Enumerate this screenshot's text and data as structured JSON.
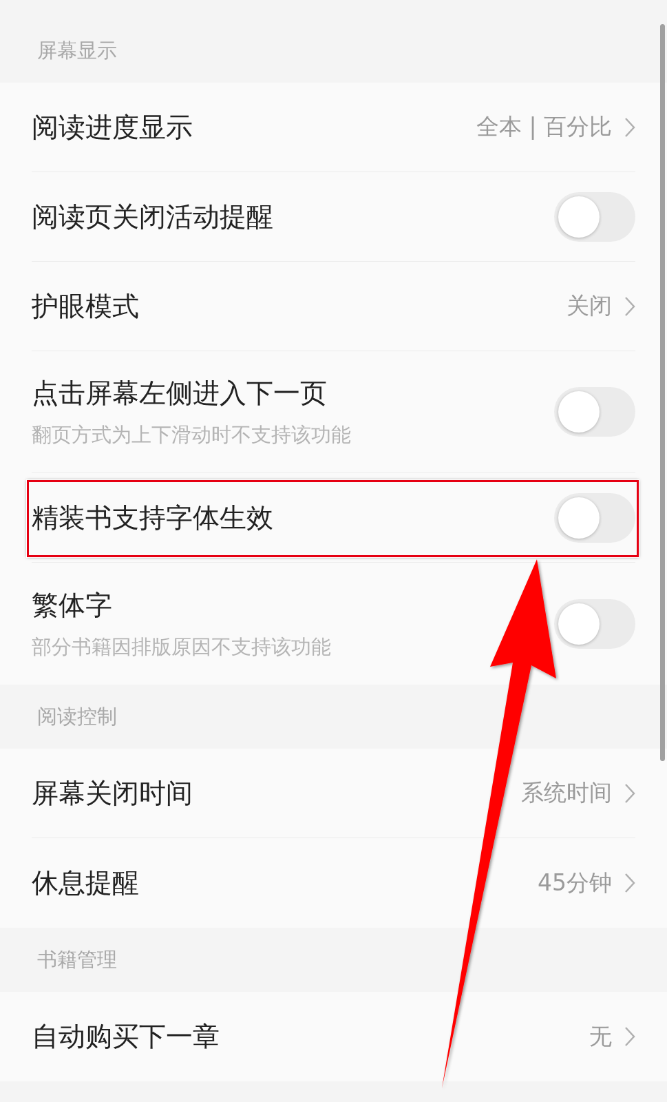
{
  "sections": [
    {
      "header": "屏幕显示",
      "items": [
        {
          "kind": "link",
          "title": "阅读进度显示",
          "value": "全本 | 百分比",
          "highlighted": false
        },
        {
          "kind": "toggle",
          "title": "阅读页关闭活动提醒",
          "on": false,
          "highlighted": false
        },
        {
          "kind": "link",
          "title": "护眼模式",
          "value": "关闭",
          "highlighted": false
        },
        {
          "kind": "toggle",
          "title": "点击屏幕左侧进入下一页",
          "subtitle": "翻页方式为上下滑动时不支持该功能",
          "on": false,
          "highlighted": false
        },
        {
          "kind": "toggle",
          "title": "精装书支持字体生效",
          "on": false,
          "highlighted": true
        },
        {
          "kind": "toggle",
          "title": "繁体字",
          "subtitle": "部分书籍因排版原因不支持该功能",
          "on": false,
          "highlighted": false
        }
      ]
    },
    {
      "header": "阅读控制",
      "items": [
        {
          "kind": "link",
          "title": "屏幕关闭时间",
          "value": "系统时间",
          "highlighted": false
        },
        {
          "kind": "link",
          "title": "休息提醒",
          "value": "45分钟",
          "highlighted": false
        }
      ]
    },
    {
      "header": "书籍管理",
      "items": [
        {
          "kind": "link",
          "title": "自动购买下一章",
          "value": "无",
          "highlighted": false
        }
      ]
    }
  ]
}
